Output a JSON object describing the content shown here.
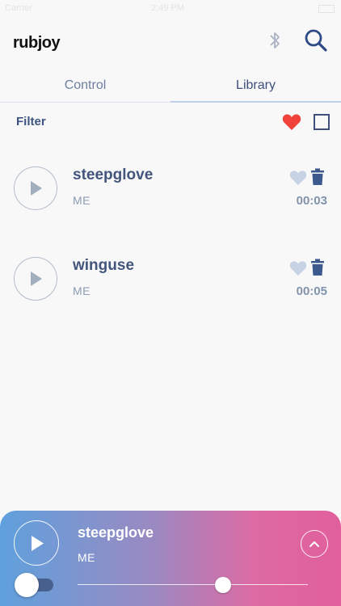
{
  "status_bar": {
    "carrier": "Carrier",
    "time": "2:49 PM"
  },
  "app": {
    "logo": "rubjoy"
  },
  "tabs": [
    {
      "label": "Control",
      "active": false
    },
    {
      "label": "Library",
      "active": true
    }
  ],
  "filter": {
    "label": "Filter"
  },
  "tracks": [
    {
      "title": "steepglove",
      "artist": "ME",
      "duration": "00:03"
    },
    {
      "title": "winguse",
      "artist": "ME",
      "duration": "00:05"
    }
  ],
  "player": {
    "title": "steepglove",
    "artist": "ME",
    "progress_fraction": 0.63
  },
  "colors": {
    "accent": "#3d4f7a",
    "favorite": "#f0413b",
    "heart_inactive": "#c7d3e5",
    "gradient_start": "#5fa1dd",
    "gradient_end": "#e05f9c"
  }
}
